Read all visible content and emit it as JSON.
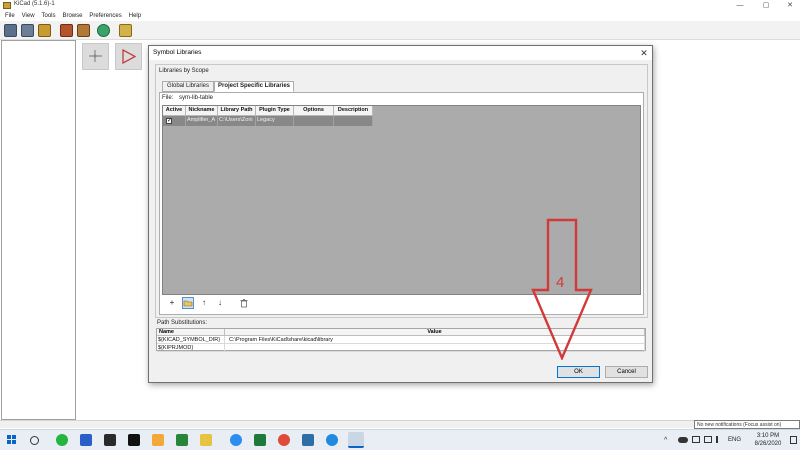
{
  "window": {
    "title": "KiCad (5.1.6)-1",
    "controls": [
      "—",
      "▢",
      "✕"
    ]
  },
  "menu": [
    "File",
    "View",
    "Tools",
    "Browse",
    "Preferences",
    "Help"
  ],
  "dialog": {
    "title": "Symbol Libraries",
    "scope_label": "Libraries by Scope",
    "tabs": [
      "Global Libraries",
      "Project Specific Libraries"
    ],
    "active_tab": "Project Specific Libraries",
    "file_label": "File:",
    "file_value": "sym-lib-table",
    "grid": {
      "headers": [
        "Active",
        "Nickname",
        "Library Path",
        "Plugin Type",
        "Options",
        "Description"
      ],
      "rows": [
        {
          "active": "✓",
          "nickname": "Amplifier_A",
          "path": "C:\\Users\\Zoni",
          "plugin": "Legacy",
          "options": "",
          "description": ""
        }
      ]
    },
    "grid_buttons": [
      "+",
      "folder",
      "↑",
      "↓",
      "trash"
    ],
    "path_subst_label": "Path Substitutions:",
    "path_table": {
      "headers": [
        "Name",
        "Value"
      ],
      "rows": [
        {
          "name": "${KICAD_SYMBOL_DIR}",
          "value": "C:\\Program Files\\KiCad\\share\\kicad\\library"
        },
        {
          "name": "${KIPRJMOD}",
          "value": ""
        }
      ]
    },
    "ok_label": "OK",
    "cancel_label": "Cancel"
  },
  "annotation": {
    "number": "4",
    "color": "#d23a3a"
  },
  "notification": "No new notifications (Focus assist on)",
  "taskbar": {
    "language": "ENG",
    "time": "3:10 PM",
    "date": "8/26/2020"
  }
}
